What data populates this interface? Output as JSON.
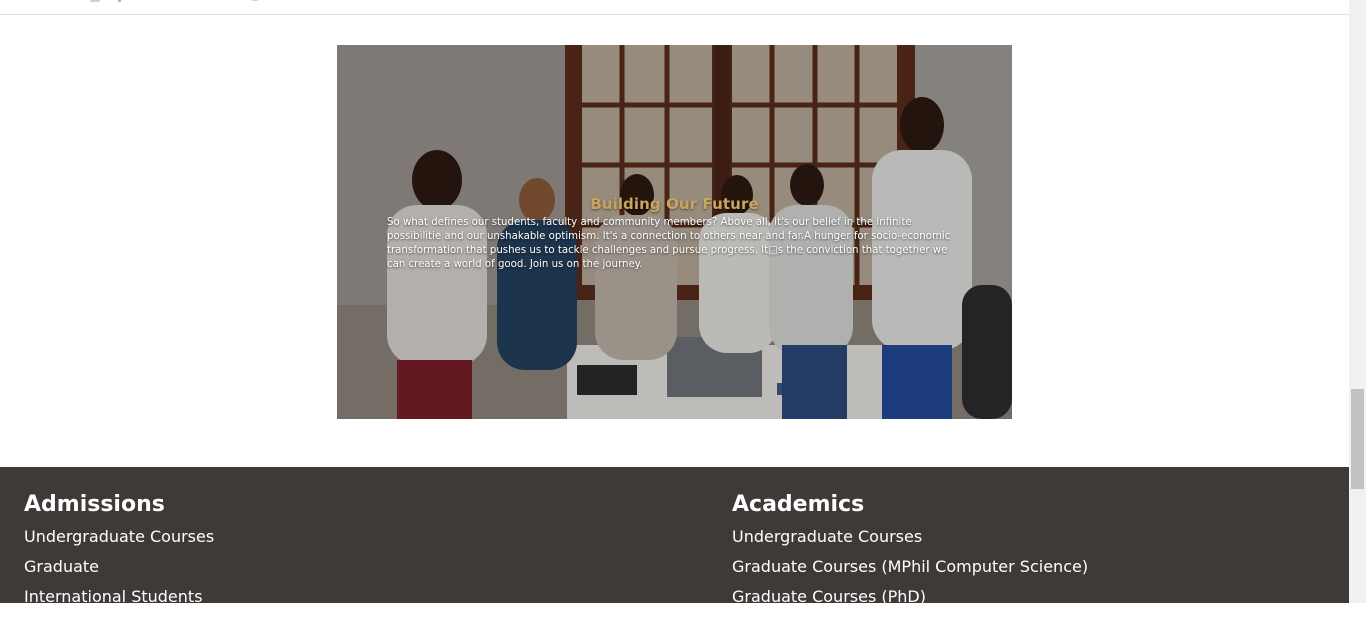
{
  "hero": {
    "title": "Building Our Future",
    "text": "So what defines our students, faculty and community members? Above all, it's our belief in the infinite possibilitie and our unshakable optimism. It's a connection to others near and far.A hunger for socio-economic transformation that pushes us to tackle challenges and pursue progress. It□s the conviction that together we can create a world of good. Join us on the journey."
  },
  "footer": {
    "admissions": {
      "heading": "Admissions",
      "links": [
        "Undergraduate Courses",
        "Graduate",
        "International Students"
      ]
    },
    "academics": {
      "heading": "Academics",
      "links": [
        "Undergraduate Courses",
        "Graduate Courses (MPhil Computer Science)",
        "Graduate Courses (PhD)"
      ]
    }
  },
  "colors": {
    "footer_bg": "#3f3a37",
    "hero_title": "#c8a45d"
  }
}
